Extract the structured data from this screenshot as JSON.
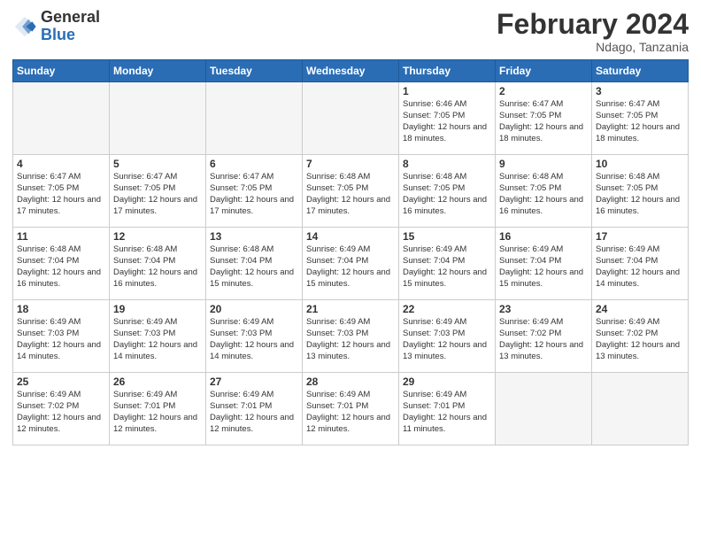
{
  "header": {
    "logo_general": "General",
    "logo_blue": "Blue",
    "month_year": "February 2024",
    "location": "Ndago, Tanzania"
  },
  "calendar": {
    "days_of_week": [
      "Sunday",
      "Monday",
      "Tuesday",
      "Wednesday",
      "Thursday",
      "Friday",
      "Saturday"
    ],
    "weeks": [
      [
        {
          "day": "",
          "info": ""
        },
        {
          "day": "",
          "info": ""
        },
        {
          "day": "",
          "info": ""
        },
        {
          "day": "",
          "info": ""
        },
        {
          "day": "1",
          "info": "Sunrise: 6:46 AM\nSunset: 7:05 PM\nDaylight: 12 hours and 18 minutes."
        },
        {
          "day": "2",
          "info": "Sunrise: 6:47 AM\nSunset: 7:05 PM\nDaylight: 12 hours and 18 minutes."
        },
        {
          "day": "3",
          "info": "Sunrise: 6:47 AM\nSunset: 7:05 PM\nDaylight: 12 hours and 18 minutes."
        }
      ],
      [
        {
          "day": "4",
          "info": "Sunrise: 6:47 AM\nSunset: 7:05 PM\nDaylight: 12 hours and 17 minutes."
        },
        {
          "day": "5",
          "info": "Sunrise: 6:47 AM\nSunset: 7:05 PM\nDaylight: 12 hours and 17 minutes."
        },
        {
          "day": "6",
          "info": "Sunrise: 6:47 AM\nSunset: 7:05 PM\nDaylight: 12 hours and 17 minutes."
        },
        {
          "day": "7",
          "info": "Sunrise: 6:48 AM\nSunset: 7:05 PM\nDaylight: 12 hours and 17 minutes."
        },
        {
          "day": "8",
          "info": "Sunrise: 6:48 AM\nSunset: 7:05 PM\nDaylight: 12 hours and 16 minutes."
        },
        {
          "day": "9",
          "info": "Sunrise: 6:48 AM\nSunset: 7:05 PM\nDaylight: 12 hours and 16 minutes."
        },
        {
          "day": "10",
          "info": "Sunrise: 6:48 AM\nSunset: 7:05 PM\nDaylight: 12 hours and 16 minutes."
        }
      ],
      [
        {
          "day": "11",
          "info": "Sunrise: 6:48 AM\nSunset: 7:04 PM\nDaylight: 12 hours and 16 minutes."
        },
        {
          "day": "12",
          "info": "Sunrise: 6:48 AM\nSunset: 7:04 PM\nDaylight: 12 hours and 16 minutes."
        },
        {
          "day": "13",
          "info": "Sunrise: 6:48 AM\nSunset: 7:04 PM\nDaylight: 12 hours and 15 minutes."
        },
        {
          "day": "14",
          "info": "Sunrise: 6:49 AM\nSunset: 7:04 PM\nDaylight: 12 hours and 15 minutes."
        },
        {
          "day": "15",
          "info": "Sunrise: 6:49 AM\nSunset: 7:04 PM\nDaylight: 12 hours and 15 minutes."
        },
        {
          "day": "16",
          "info": "Sunrise: 6:49 AM\nSunset: 7:04 PM\nDaylight: 12 hours and 15 minutes."
        },
        {
          "day": "17",
          "info": "Sunrise: 6:49 AM\nSunset: 7:04 PM\nDaylight: 12 hours and 14 minutes."
        }
      ],
      [
        {
          "day": "18",
          "info": "Sunrise: 6:49 AM\nSunset: 7:03 PM\nDaylight: 12 hours and 14 minutes."
        },
        {
          "day": "19",
          "info": "Sunrise: 6:49 AM\nSunset: 7:03 PM\nDaylight: 12 hours and 14 minutes."
        },
        {
          "day": "20",
          "info": "Sunrise: 6:49 AM\nSunset: 7:03 PM\nDaylight: 12 hours and 14 minutes."
        },
        {
          "day": "21",
          "info": "Sunrise: 6:49 AM\nSunset: 7:03 PM\nDaylight: 12 hours and 13 minutes."
        },
        {
          "day": "22",
          "info": "Sunrise: 6:49 AM\nSunset: 7:03 PM\nDaylight: 12 hours and 13 minutes."
        },
        {
          "day": "23",
          "info": "Sunrise: 6:49 AM\nSunset: 7:02 PM\nDaylight: 12 hours and 13 minutes."
        },
        {
          "day": "24",
          "info": "Sunrise: 6:49 AM\nSunset: 7:02 PM\nDaylight: 12 hours and 13 minutes."
        }
      ],
      [
        {
          "day": "25",
          "info": "Sunrise: 6:49 AM\nSunset: 7:02 PM\nDaylight: 12 hours and 12 minutes."
        },
        {
          "day": "26",
          "info": "Sunrise: 6:49 AM\nSunset: 7:01 PM\nDaylight: 12 hours and 12 minutes."
        },
        {
          "day": "27",
          "info": "Sunrise: 6:49 AM\nSunset: 7:01 PM\nDaylight: 12 hours and 12 minutes."
        },
        {
          "day": "28",
          "info": "Sunrise: 6:49 AM\nSunset: 7:01 PM\nDaylight: 12 hours and 12 minutes."
        },
        {
          "day": "29",
          "info": "Sunrise: 6:49 AM\nSunset: 7:01 PM\nDaylight: 12 hours and 11 minutes."
        },
        {
          "day": "",
          "info": ""
        },
        {
          "day": "",
          "info": ""
        }
      ]
    ]
  }
}
